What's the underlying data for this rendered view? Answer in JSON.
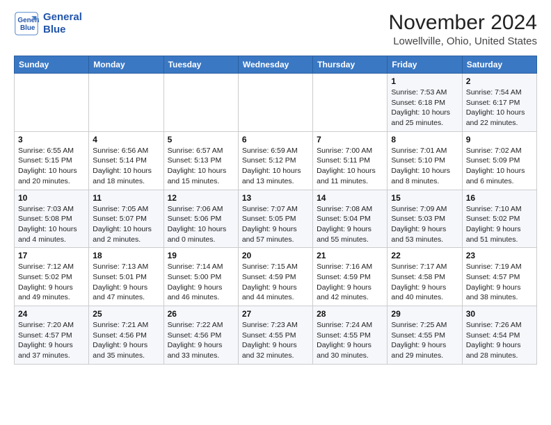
{
  "logo": {
    "line1": "General",
    "line2": "Blue"
  },
  "header": {
    "title": "November 2024",
    "subtitle": "Lowellville, Ohio, United States"
  },
  "weekdays": [
    "Sunday",
    "Monday",
    "Tuesday",
    "Wednesday",
    "Thursday",
    "Friday",
    "Saturday"
  ],
  "weeks": [
    [
      {
        "day": "",
        "info": ""
      },
      {
        "day": "",
        "info": ""
      },
      {
        "day": "",
        "info": ""
      },
      {
        "day": "",
        "info": ""
      },
      {
        "day": "",
        "info": ""
      },
      {
        "day": "1",
        "info": "Sunrise: 7:53 AM\nSunset: 6:18 PM\nDaylight: 10 hours\nand 25 minutes."
      },
      {
        "day": "2",
        "info": "Sunrise: 7:54 AM\nSunset: 6:17 PM\nDaylight: 10 hours\nand 22 minutes."
      }
    ],
    [
      {
        "day": "3",
        "info": "Sunrise: 6:55 AM\nSunset: 5:15 PM\nDaylight: 10 hours\nand 20 minutes."
      },
      {
        "day": "4",
        "info": "Sunrise: 6:56 AM\nSunset: 5:14 PM\nDaylight: 10 hours\nand 18 minutes."
      },
      {
        "day": "5",
        "info": "Sunrise: 6:57 AM\nSunset: 5:13 PM\nDaylight: 10 hours\nand 15 minutes."
      },
      {
        "day": "6",
        "info": "Sunrise: 6:59 AM\nSunset: 5:12 PM\nDaylight: 10 hours\nand 13 minutes."
      },
      {
        "day": "7",
        "info": "Sunrise: 7:00 AM\nSunset: 5:11 PM\nDaylight: 10 hours\nand 11 minutes."
      },
      {
        "day": "8",
        "info": "Sunrise: 7:01 AM\nSunset: 5:10 PM\nDaylight: 10 hours\nand 8 minutes."
      },
      {
        "day": "9",
        "info": "Sunrise: 7:02 AM\nSunset: 5:09 PM\nDaylight: 10 hours\nand 6 minutes."
      }
    ],
    [
      {
        "day": "10",
        "info": "Sunrise: 7:03 AM\nSunset: 5:08 PM\nDaylight: 10 hours\nand 4 minutes."
      },
      {
        "day": "11",
        "info": "Sunrise: 7:05 AM\nSunset: 5:07 PM\nDaylight: 10 hours\nand 2 minutes."
      },
      {
        "day": "12",
        "info": "Sunrise: 7:06 AM\nSunset: 5:06 PM\nDaylight: 10 hours\nand 0 minutes."
      },
      {
        "day": "13",
        "info": "Sunrise: 7:07 AM\nSunset: 5:05 PM\nDaylight: 9 hours\nand 57 minutes."
      },
      {
        "day": "14",
        "info": "Sunrise: 7:08 AM\nSunset: 5:04 PM\nDaylight: 9 hours\nand 55 minutes."
      },
      {
        "day": "15",
        "info": "Sunrise: 7:09 AM\nSunset: 5:03 PM\nDaylight: 9 hours\nand 53 minutes."
      },
      {
        "day": "16",
        "info": "Sunrise: 7:10 AM\nSunset: 5:02 PM\nDaylight: 9 hours\nand 51 minutes."
      }
    ],
    [
      {
        "day": "17",
        "info": "Sunrise: 7:12 AM\nSunset: 5:02 PM\nDaylight: 9 hours\nand 49 minutes."
      },
      {
        "day": "18",
        "info": "Sunrise: 7:13 AM\nSunset: 5:01 PM\nDaylight: 9 hours\nand 47 minutes."
      },
      {
        "day": "19",
        "info": "Sunrise: 7:14 AM\nSunset: 5:00 PM\nDaylight: 9 hours\nand 46 minutes."
      },
      {
        "day": "20",
        "info": "Sunrise: 7:15 AM\nSunset: 4:59 PM\nDaylight: 9 hours\nand 44 minutes."
      },
      {
        "day": "21",
        "info": "Sunrise: 7:16 AM\nSunset: 4:59 PM\nDaylight: 9 hours\nand 42 minutes."
      },
      {
        "day": "22",
        "info": "Sunrise: 7:17 AM\nSunset: 4:58 PM\nDaylight: 9 hours\nand 40 minutes."
      },
      {
        "day": "23",
        "info": "Sunrise: 7:19 AM\nSunset: 4:57 PM\nDaylight: 9 hours\nand 38 minutes."
      }
    ],
    [
      {
        "day": "24",
        "info": "Sunrise: 7:20 AM\nSunset: 4:57 PM\nDaylight: 9 hours\nand 37 minutes."
      },
      {
        "day": "25",
        "info": "Sunrise: 7:21 AM\nSunset: 4:56 PM\nDaylight: 9 hours\nand 35 minutes."
      },
      {
        "day": "26",
        "info": "Sunrise: 7:22 AM\nSunset: 4:56 PM\nDaylight: 9 hours\nand 33 minutes."
      },
      {
        "day": "27",
        "info": "Sunrise: 7:23 AM\nSunset: 4:55 PM\nDaylight: 9 hours\nand 32 minutes."
      },
      {
        "day": "28",
        "info": "Sunrise: 7:24 AM\nSunset: 4:55 PM\nDaylight: 9 hours\nand 30 minutes."
      },
      {
        "day": "29",
        "info": "Sunrise: 7:25 AM\nSunset: 4:55 PM\nDaylight: 9 hours\nand 29 minutes."
      },
      {
        "day": "30",
        "info": "Sunrise: 7:26 AM\nSunset: 4:54 PM\nDaylight: 9 hours\nand 28 minutes."
      }
    ]
  ]
}
